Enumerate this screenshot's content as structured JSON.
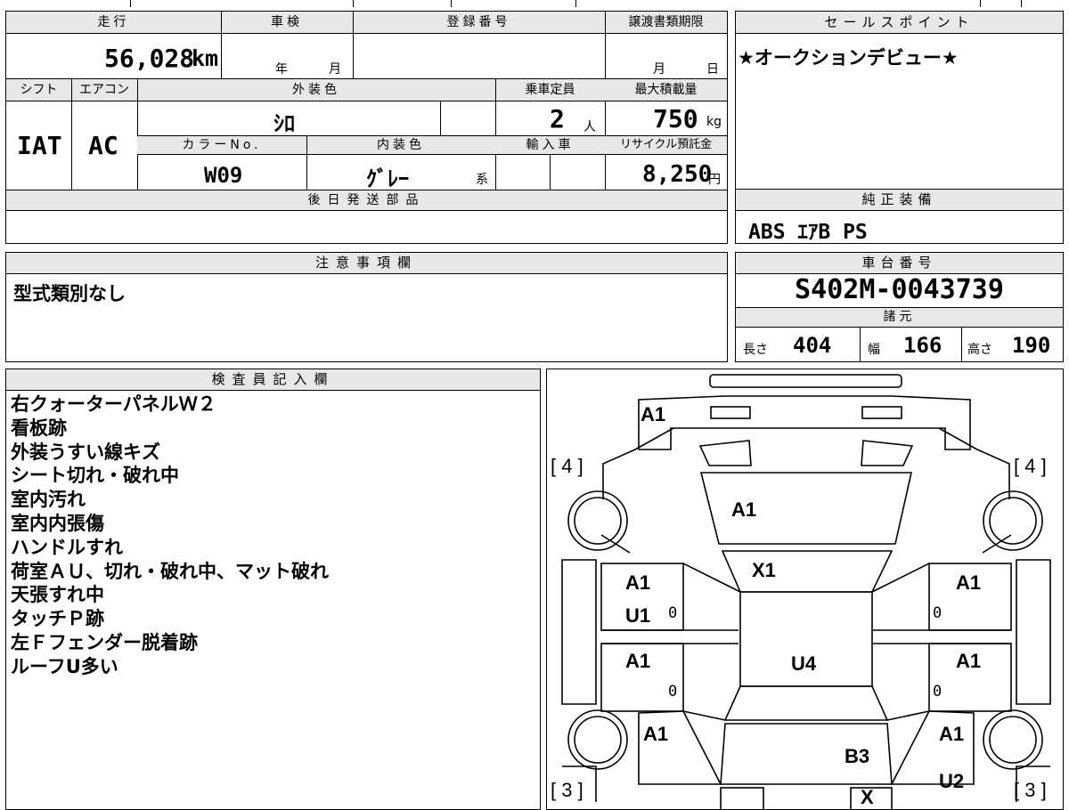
{
  "vehicle": {
    "mileage_label": "走行",
    "mileage": "56,028",
    "mileage_unit": "km",
    "inspection_label": "車検",
    "inspection_year_unit": "年",
    "inspection_month_unit": "月",
    "registration_label": "登録番号",
    "transfer_deadline_label": "譲渡書類期限",
    "transfer_month_unit": "月",
    "transfer_day_unit": "日",
    "shift_label": "シフト",
    "shift": "IAT",
    "aircon_label": "エアコン",
    "aircon": "AC",
    "exterior_color_label": "外装色",
    "exterior_color": "ｼﾛ",
    "capacity_label": "乗車定員",
    "capacity": "2",
    "capacity_unit": "人",
    "max_load_label": "最大積載量",
    "max_load": "750",
    "max_load_unit": "kg",
    "color_no_label": "カラーNo.",
    "color_no": "W09",
    "interior_color_label": "内装色",
    "interior_color": "ｸﾞﾚｰ",
    "interior_suffix": "系",
    "import_label": "輸入車",
    "recycle_label": "リサイクル預託金",
    "recycle_fee": "8,250",
    "recycle_unit": "円",
    "later_parts_label": "後日発送部品"
  },
  "sales_point": {
    "label": "セールスポイント",
    "text": "★オークションデビュー★"
  },
  "equipment": {
    "label": "純正装備",
    "text": "ABS ｴｱB PS"
  },
  "notes": {
    "label": "注意事項欄",
    "text": "型式類別なし"
  },
  "chassis": {
    "label": "車台番号",
    "number": "S402M-0043739",
    "specs_label": "諸元",
    "length_label": "長さ",
    "length": "404",
    "width_label": "幅",
    "width": "166",
    "height_label": "高さ",
    "height": "190"
  },
  "inspector": {
    "label": "検査員記入欄",
    "lines": [
      "右クォーターパネルＷ２",
      "看板跡",
      "外装うすい線キズ",
      "シート切れ・破れ中",
      "室内汚れ",
      "室内内張傷",
      "ハンドルすれ",
      "荷室ＡＵ、切れ・破れ中、マット破れ",
      "天張すれ中",
      "タッチＰ跡",
      "左Ｆフェンダー脱着跡",
      "ルーフU多い"
    ]
  },
  "diagram": {
    "marks": {
      "front": "A1",
      "hood": "A1",
      "windshield": "X1",
      "lf_door_a": "A1",
      "lf_door_u": "U1",
      "rf_door": "A1",
      "lr_door": "A1",
      "rr_door": "A1",
      "roof": "U4",
      "lr_quarter": "A1",
      "rr_quarter": "A1",
      "cargo": "B3",
      "rr_lower": "U2",
      "rear": "X"
    },
    "zero": "0",
    "tires": {
      "lf": "4",
      "rf": "4",
      "lr": "3",
      "rr": "3"
    }
  }
}
